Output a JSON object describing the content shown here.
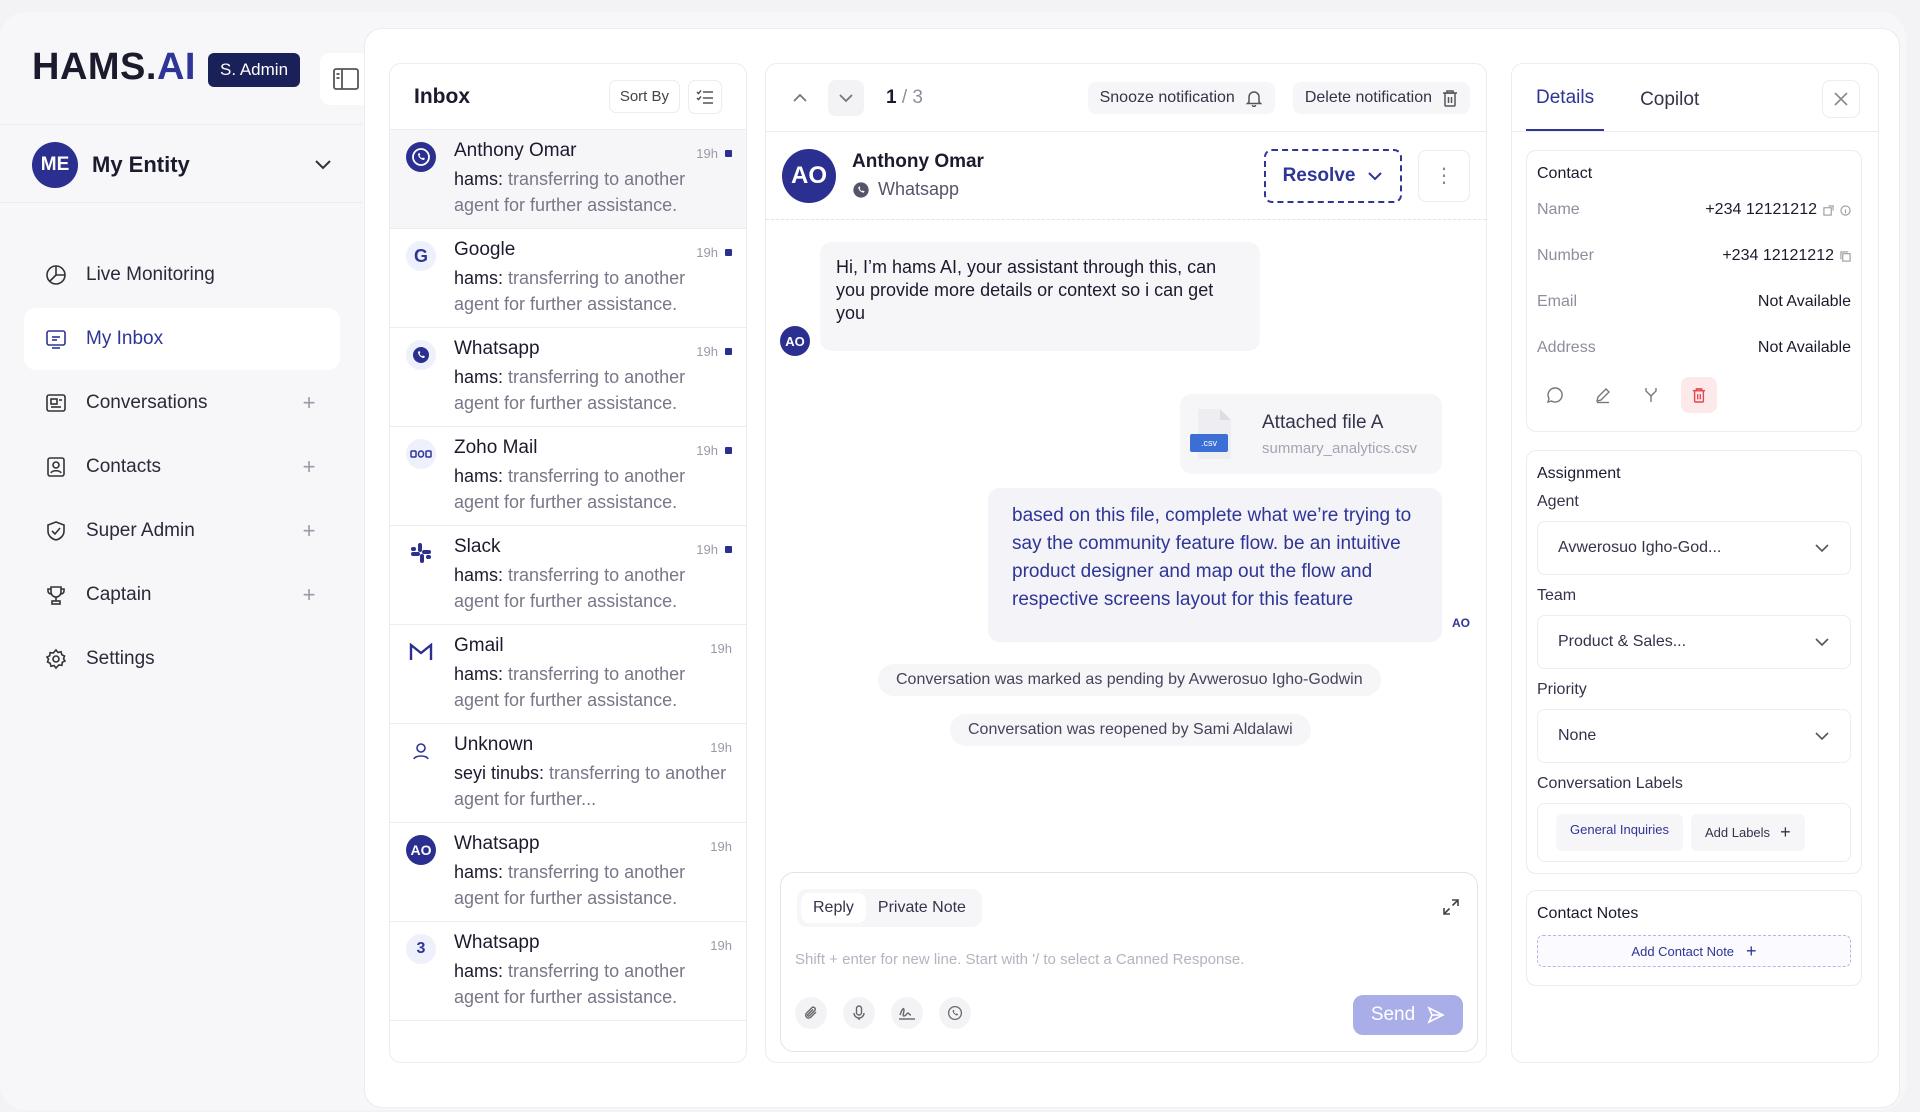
{
  "sidebar": {
    "brand_main": "HAMS.",
    "brand_ai": "AI",
    "role_badge": "S. Admin",
    "entity_initials": "ME",
    "entity_name": "My Entity",
    "nav": [
      {
        "label": "Live Monitoring",
        "icon": "pie-chart-icon",
        "active": false
      },
      {
        "label": "My Inbox",
        "icon": "inbox-icon",
        "active": true
      },
      {
        "label": "Conversations",
        "icon": "conversations-icon",
        "active": false
      },
      {
        "label": "Contacts",
        "icon": "contacts-icon",
        "active": false
      },
      {
        "label": "Super Admin",
        "icon": "shield-icon",
        "active": false
      },
      {
        "label": "Captain",
        "icon": "trophy-icon",
        "active": false
      },
      {
        "label": "Settings",
        "icon": "gear-icon",
        "active": false
      }
    ]
  },
  "inbox": {
    "title": "Inbox",
    "sort_label": "Sort By",
    "items": [
      {
        "name": "Anthony Omar",
        "icon": "whatsapp-icon",
        "time": "19h",
        "unread": true,
        "sender": "hams:",
        "text": " transferring to another agent for further assistance."
      },
      {
        "name": "Google",
        "icon": "google-icon",
        "time": "19h",
        "unread": true,
        "sender": "hams:",
        "text": " transferring to another agent for further assistance."
      },
      {
        "name": "Whatsapp",
        "icon": "whatsapp-icon",
        "time": "19h",
        "unread": true,
        "sender": "hams:",
        "text": " transferring to another agent for further assistance."
      },
      {
        "name": "Zoho Mail",
        "icon": "zoho-icon",
        "time": "19h",
        "unread": true,
        "sender": "hams:",
        "text": " transferring to another agent for further assistance."
      },
      {
        "name": "Slack",
        "icon": "slack-icon",
        "time": "19h",
        "unread": true,
        "sender": "hams:",
        "text": " transferring to another agent for further assistance."
      },
      {
        "name": "Gmail",
        "icon": "gmail-icon",
        "time": "19h",
        "unread": false,
        "sender": "hams:",
        "text": " transferring to another agent for further assistance."
      },
      {
        "name": "Unknown",
        "icon": "user-icon",
        "time": "19h",
        "unread": false,
        "sender": "seyi tinubs:",
        "text": " transferring to another agent for further..."
      },
      {
        "name": "Whatsapp",
        "icon": "ao-avatar",
        "badge": "AO",
        "time": "19h",
        "unread": false,
        "sender": "hams:",
        "text": " transferring to another agent for further assistance."
      },
      {
        "name": "Whatsapp",
        "icon": "count-badge",
        "badge": "3",
        "time": "19h",
        "unread": false,
        "sender": "hams:",
        "text": " transferring to another agent for further assistance."
      }
    ]
  },
  "chat": {
    "pager_current": "1",
    "pager_total": " / 3",
    "snooze_label": "Snooze notification",
    "delete_label": "Delete notification",
    "contact_initials": "AO",
    "contact_name": "Anthony Omar",
    "contact_channel": "Whatsapp",
    "resolve_label": "Resolve",
    "incoming_message": "Hi, I’m hams AI, your assistant through this, can you provide more details or context so i can get you",
    "incoming_avatar": "AO",
    "attachment_title": "Attached file A",
    "attachment_name": "summary_analytics.csv",
    "attachment_ext": ".csv",
    "outgoing_message": "based on this file, complete what we’re trying to say the community feature flow. be an intuitive product designer and map out the flow and respective screens layout for this feature",
    "outgoing_avatar": "AO",
    "system_messages": [
      "Conversation was marked as pending by Avwerosuo Igho-Godwin",
      "Conversation was reopened by Sami Aldalawi"
    ],
    "composer": {
      "tab_reply": "Reply",
      "tab_private": "Private Note",
      "placeholder": "Shift + enter for new line. Start with '/ to select a Canned Response.",
      "send_label": "Send"
    }
  },
  "details": {
    "tab_details": "Details",
    "tab_copilot": "Copilot",
    "contact": {
      "title": "Contact",
      "rows": [
        {
          "k": "Name",
          "v": "+234 12121212"
        },
        {
          "k": "Number",
          "v": "+234 12121212"
        },
        {
          "k": "Email",
          "v": "Not Available"
        },
        {
          "k": "Address",
          "v": "Not Available"
        }
      ]
    },
    "assignment": {
      "title": "Assignment",
      "agent_label": "Agent",
      "agent_value": "Avwerosuo Igho-God...",
      "team_label": "Team",
      "team_value": "Product & Sales...",
      "priority_label": "Priority",
      "priority_value": "None",
      "labels_label": "Conversation Labels",
      "label_chip": "General Inquiries",
      "add_labels": "Add Labels"
    },
    "notes": {
      "title": "Contact Notes",
      "add_note": "Add Contact Note"
    }
  },
  "colors": {
    "brand": "#2e3596",
    "brand_dark": "#1a2158",
    "send_disabled": "#a9aee8",
    "danger": "#e5484d"
  }
}
